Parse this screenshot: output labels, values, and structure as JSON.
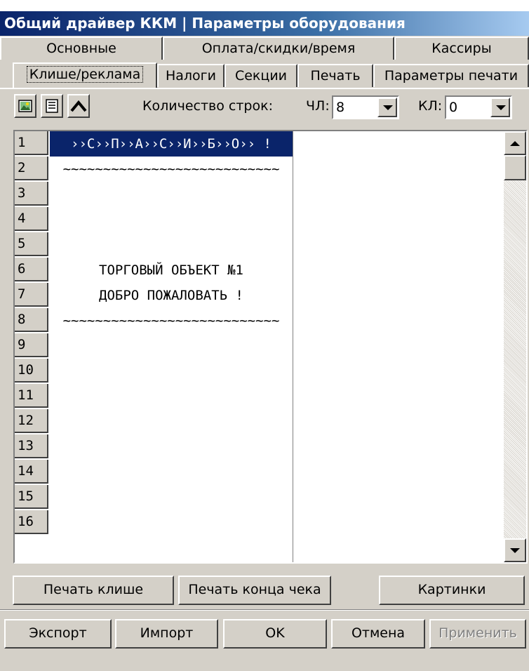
{
  "window": {
    "title": "Общий драйвер ККМ | Параметры оборудования"
  },
  "tabs_row1": [
    "Основные",
    "Оплата/скидки/время",
    "Кассиры"
  ],
  "tabs_row2": [
    "Клише/реклама",
    "Налоги",
    "Секции",
    "Печать",
    "Параметры печати"
  ],
  "toolbar": {
    "icons": [
      "image-icon",
      "text-align-icon",
      "caret-up-icon"
    ],
    "lines_label": "Количество строк:",
    "chl_label": "ЧЛ:",
    "chl_value": "8",
    "kl_label": "КЛ:",
    "kl_value": "0"
  },
  "rows": [
    {
      "num": "1",
      "text": "››С››П››А››С››И››Б››О›› !"
    },
    {
      "num": "2",
      "text": "~~~~~~~~~~~~~~~~~~~~~~~~~~~"
    },
    {
      "num": "3",
      "text": ""
    },
    {
      "num": "4",
      "text": ""
    },
    {
      "num": "5",
      "text": ""
    },
    {
      "num": "6",
      "text": "ТОРГОВЫЙ ОБЪЕКТ №1"
    },
    {
      "num": "7",
      "text": "ДОБРО ПОЖАЛОВАТЬ !"
    },
    {
      "num": "8",
      "text": "~~~~~~~~~~~~~~~~~~~~~~~~~~~"
    },
    {
      "num": "9",
      "text": ""
    },
    {
      "num": "10",
      "text": ""
    },
    {
      "num": "11",
      "text": ""
    },
    {
      "num": "12",
      "text": ""
    },
    {
      "num": "13",
      "text": ""
    },
    {
      "num": "14",
      "text": ""
    },
    {
      "num": "15",
      "text": ""
    },
    {
      "num": "16",
      "text": ""
    }
  ],
  "actions": {
    "print_cliche": "Печать клише",
    "print_end": "Печать конца чека",
    "pictures": "Картинки"
  },
  "footer": {
    "export": "Экспорт",
    "import": "Импорт",
    "ok": "OK",
    "cancel": "Отмена",
    "apply": "Применить"
  }
}
